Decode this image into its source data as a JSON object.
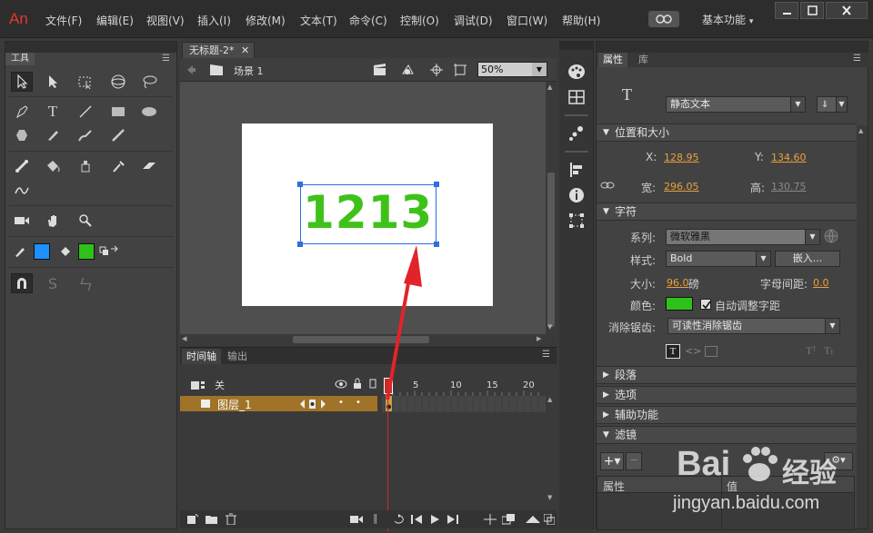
{
  "app": {
    "logo": "An"
  },
  "menu": [
    "文件(F)",
    "编辑(E)",
    "视图(V)",
    "插入(I)",
    "修改(M)",
    "文本(T)",
    "命令(C)",
    "控制(O)",
    "调试(D)",
    "窗口(W)",
    "帮助(H)"
  ],
  "workspace": {
    "label": "基本功能"
  },
  "tools_panel": {
    "tab": "工具"
  },
  "document": {
    "tab_title": "无标题-2*",
    "scene": "场景 1",
    "zoom": "50%",
    "stage_text": "1213"
  },
  "colors": {
    "stage_text": "#3ec21a",
    "fill_blue": "#1e90ff",
    "fill_green": "#2fc11b",
    "accent": "#e9a23b",
    "layer": "#a07328",
    "playhead": "#c0302a"
  },
  "timeline": {
    "tabs": [
      "时间轴",
      "输出"
    ],
    "header_label": "关",
    "layer_name": "图层_1",
    "frame_numbers": [
      "1",
      "5",
      "10",
      "15",
      "20"
    ]
  },
  "properties": {
    "tabs": [
      "属性",
      "库"
    ],
    "text_type": "静态文本",
    "position_section": "位置和大小",
    "x_label": "X:",
    "x_value": "128.95",
    "y_label": "Y:",
    "y_value": "134.60",
    "width_label": "宽:",
    "width_value": "296.05",
    "height_label": "高:",
    "height_value": "130.75",
    "char_section": "字符",
    "family_label": "系列:",
    "family_value": "微软雅黑",
    "style_label": "样式:",
    "style_value": "Bold",
    "embed_button": "嵌入...",
    "size_label": "大小:",
    "size_value": "96.0",
    "size_unit": "磅",
    "spacing_label": "字母间距:",
    "spacing_value": "0.0",
    "color_label": "颜色:",
    "autokern_label": "自动调整字距",
    "antialias_label": "消除锯齿:",
    "antialias_value": "可读性消除锯齿",
    "paragraph_section": "段落",
    "options_section": "选项",
    "accessibility_section": "辅助功能",
    "filters_section": "滤镜",
    "filter_col_prop": "属性",
    "filter_col_value": "值"
  },
  "watermark": {
    "brand": "Bai",
    "brand2": "经验",
    "url": "jingyan.baidu.com"
  }
}
